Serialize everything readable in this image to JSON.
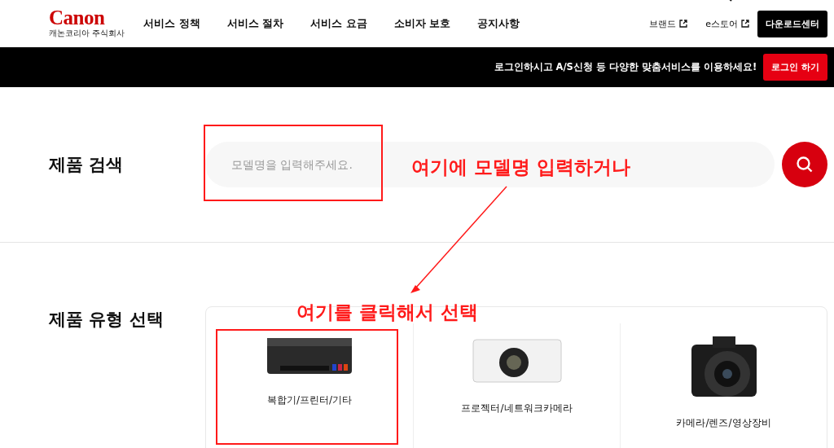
{
  "header": {
    "logo": "Canon",
    "logo_subtitle": "캐논코리아 주식회사",
    "nav": [
      {
        "label": "서비스 정책"
      },
      {
        "label": "서비스 절차"
      },
      {
        "label": "서비스 요금"
      },
      {
        "label": "소비자 보호"
      },
      {
        "label": "공지사항"
      }
    ],
    "links": [
      {
        "label": "브랜드"
      },
      {
        "label": "e스토어"
      }
    ],
    "download_button": "다운로드센터"
  },
  "login_bar": {
    "message": "로그인하시고 A/S신청 등 다양한 맞춤서비스를 이용하세요!",
    "button": "로그인 하기"
  },
  "search": {
    "title": "제품 검색",
    "placeholder": "모델명을 입력해주세요."
  },
  "product_types": {
    "title": "제품 유형 선택",
    "items": [
      {
        "kind": "printer",
        "label": "복합기/프린터/기타"
      },
      {
        "kind": "projector",
        "label": "프로젝터/네트워크카메라"
      },
      {
        "kind": "camera",
        "label": "카메라/렌즈/영상장비"
      }
    ]
  },
  "annotations": [
    {
      "text": "여기에 모델명 입력하거나"
    },
    {
      "text": "여기를 클릭해서 선택"
    }
  ]
}
